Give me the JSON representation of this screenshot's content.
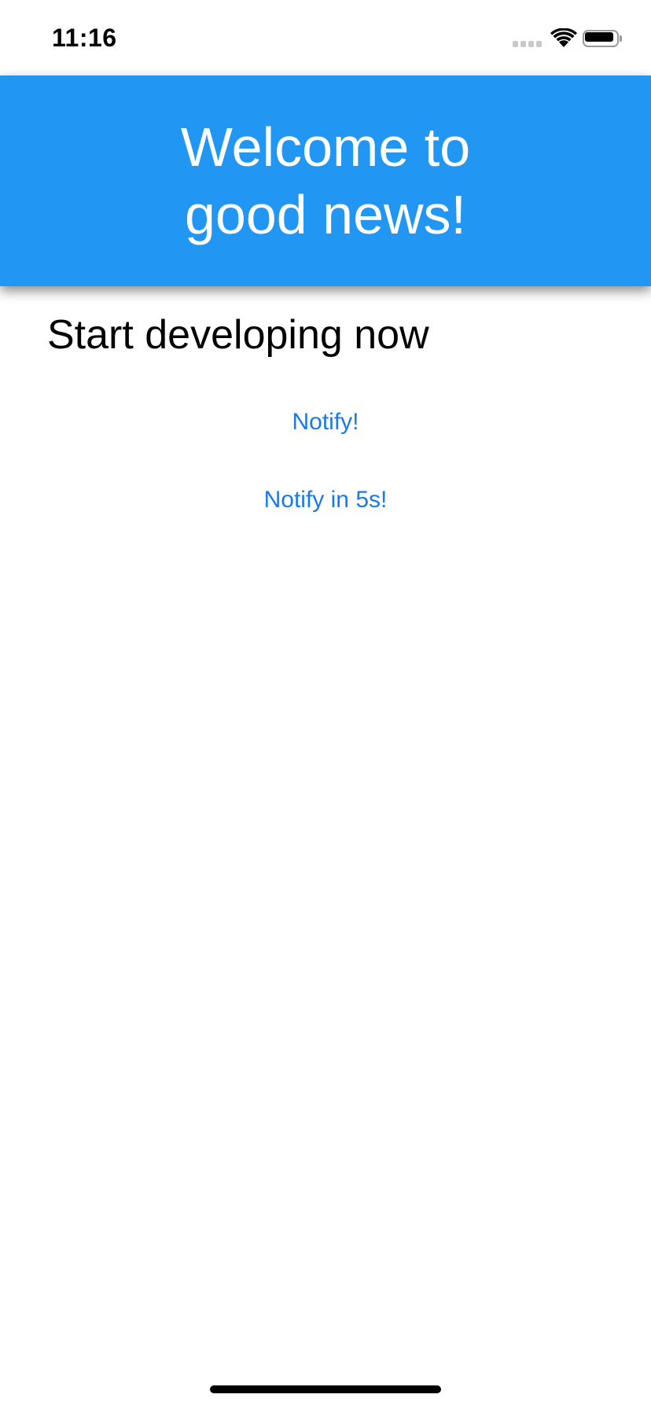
{
  "status_bar": {
    "time": "11:16",
    "icons": [
      "cellular-signal-icon",
      "wifi-icon",
      "battery-icon"
    ]
  },
  "header": {
    "title": "Welcome to good news!",
    "background_color": "#2196f3",
    "text_color": "#ffffff"
  },
  "main": {
    "heading": "Start developing now",
    "buttons": [
      {
        "label": "Notify!"
      },
      {
        "label": "Notify in 5s!"
      }
    ],
    "link_color": "#1a7ae8"
  }
}
